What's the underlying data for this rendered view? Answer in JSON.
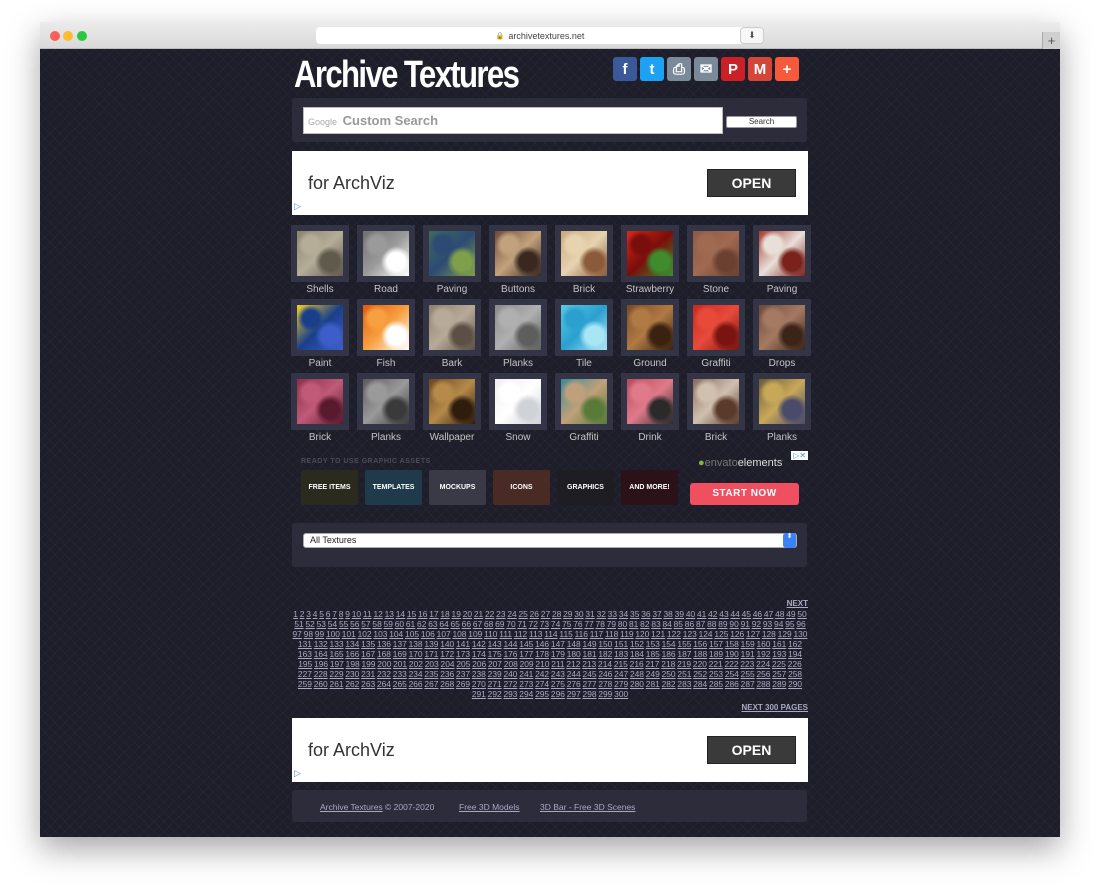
{
  "browser": {
    "url": "archivetextures.net",
    "new_tab_symbol": "+",
    "reload_symbol": "↻",
    "download_symbol": "⬇"
  },
  "header": {
    "logo": "Archive Textures",
    "share": [
      {
        "name": "facebook-icon",
        "glyph": "f",
        "color": "#3b5998"
      },
      {
        "name": "twitter-icon",
        "glyph": "t",
        "color": "#1da1f2"
      },
      {
        "name": "print-icon",
        "glyph": "⎙",
        "color": "#7a8a99"
      },
      {
        "name": "email-icon",
        "glyph": "✉",
        "color": "#7a8a99"
      },
      {
        "name": "pinterest-icon",
        "glyph": "P",
        "color": "#cb2027"
      },
      {
        "name": "gmail-icon",
        "glyph": "M",
        "color": "#d44638"
      },
      {
        "name": "more-share-icon",
        "glyph": "+",
        "color": "#f65a3b"
      }
    ]
  },
  "search": {
    "provider_label": "Google",
    "placeholder": "Custom Search",
    "button_label": "Search"
  },
  "ads": {
    "banner_text": "for ArchViz",
    "banner_button": "OPEN",
    "ad_marker": "▷"
  },
  "textures": [
    {
      "label": "Shells",
      "colors": [
        "#8a8370",
        "#b5ad98",
        "#5f5a4c"
      ]
    },
    {
      "label": "Road",
      "colors": [
        "#6f6f6f",
        "#9a9a9a",
        "#ffffff"
      ]
    },
    {
      "label": "Paving",
      "colors": [
        "#3f6b5b",
        "#2d4a74",
        "#7fa04a"
      ]
    },
    {
      "label": "Buttons",
      "colors": [
        "#6d4a3a",
        "#c2a27d",
        "#3a2820"
      ]
    },
    {
      "label": "Brick",
      "colors": [
        "#c7a97a",
        "#e6d3b0",
        "#8b5a3a"
      ]
    },
    {
      "label": "Strawberry",
      "colors": [
        "#d8281d",
        "#7a0e0a",
        "#3e8c2e"
      ]
    },
    {
      "label": "Stone",
      "colors": [
        "#8b5a45",
        "#a06a50",
        "#6b4030"
      ]
    },
    {
      "label": "Paving",
      "colors": [
        "#a43a32",
        "#e8e0d8",
        "#7a221c"
      ]
    },
    {
      "label": "Paint",
      "colors": [
        "#f2d02a",
        "#1a3f8a",
        "#3d5dc9"
      ]
    },
    {
      "label": "Fish",
      "colors": [
        "#e05a10",
        "#f7a040",
        "#ffffff"
      ]
    },
    {
      "label": "Bark",
      "colors": [
        "#8e8070",
        "#b8aa98",
        "#5c5045"
      ]
    },
    {
      "label": "Planks",
      "colors": [
        "#8a8a8a",
        "#b0b0b0",
        "#5e5e5e"
      ]
    },
    {
      "label": "Tile",
      "colors": [
        "#5ec8e6",
        "#2aa0cf",
        "#a8e6f5"
      ]
    },
    {
      "label": "Ground",
      "colors": [
        "#7a4a25",
        "#b07a45",
        "#3a2210"
      ]
    },
    {
      "label": "Graffiti",
      "colors": [
        "#c42822",
        "#e84a3a",
        "#7a1410"
      ]
    },
    {
      "label": "Drops",
      "colors": [
        "#6b4838",
        "#a57a62",
        "#3b2418"
      ]
    },
    {
      "label": "Brick",
      "colors": [
        "#8a3048",
        "#c05a78",
        "#5a1a2e"
      ]
    },
    {
      "label": "Planks",
      "colors": [
        "#5a5a5a",
        "#9a9a9a",
        "#3a3a3a"
      ]
    },
    {
      "label": "Wallpaper",
      "colors": [
        "#6b4420",
        "#b58a4a",
        "#2e1c0c"
      ]
    },
    {
      "label": "Snow",
      "colors": [
        "#eeeeee",
        "#ffffff",
        "#cfd3d8"
      ]
    },
    {
      "label": "Graffiti",
      "colors": [
        "#3a8a9a",
        "#c0a07a",
        "#5a7a3a"
      ]
    },
    {
      "label": "Drink",
      "colors": [
        "#b84a5a",
        "#e07a8a",
        "#2a2a2a"
      ]
    },
    {
      "label": "Brick",
      "colors": [
        "#8a6a5a",
        "#d0c0b0",
        "#5a3a2a"
      ]
    },
    {
      "label": "Planks",
      "colors": [
        "#6a5a3a",
        "#c8a858",
        "#4a4a6a"
      ]
    }
  ],
  "envato": {
    "heading": "READY TO USE GRAPHIC ASSETS",
    "logo_prefix": "envato",
    "logo_suffix": "elements",
    "close_marks": "▷✕",
    "buttons": [
      {
        "label": "FREE ITEMS",
        "color": "#2a2a1e"
      },
      {
        "label": "TEMPLATES",
        "color": "#1f3a4a"
      },
      {
        "label": "MOCKUPS",
        "color": "#3a3a46"
      },
      {
        "label": "ICONS",
        "color": "#4a2a24"
      },
      {
        "label": "GRAPHICS",
        "color": "#1e1e22"
      },
      {
        "label": "AND MORE!",
        "color": "#2a1218"
      }
    ],
    "cta": "START NOW"
  },
  "category_select": {
    "selected": "All Textures",
    "arrow": "⬍"
  },
  "pagination": {
    "next_label": "NEXT",
    "next300_label": "NEXT 300 PAGES",
    "first_page": 1,
    "last_page": 300
  },
  "footer": {
    "site_link": "Archive Textures",
    "copyright": " © 2007-2020",
    "link2": "Free 3D Models",
    "link3": "3D Bar - Free 3D Scenes"
  },
  "window_controls": {
    "close_color": "#fc5f57",
    "min_color": "#fdbc2e",
    "max_color": "#28c840"
  }
}
